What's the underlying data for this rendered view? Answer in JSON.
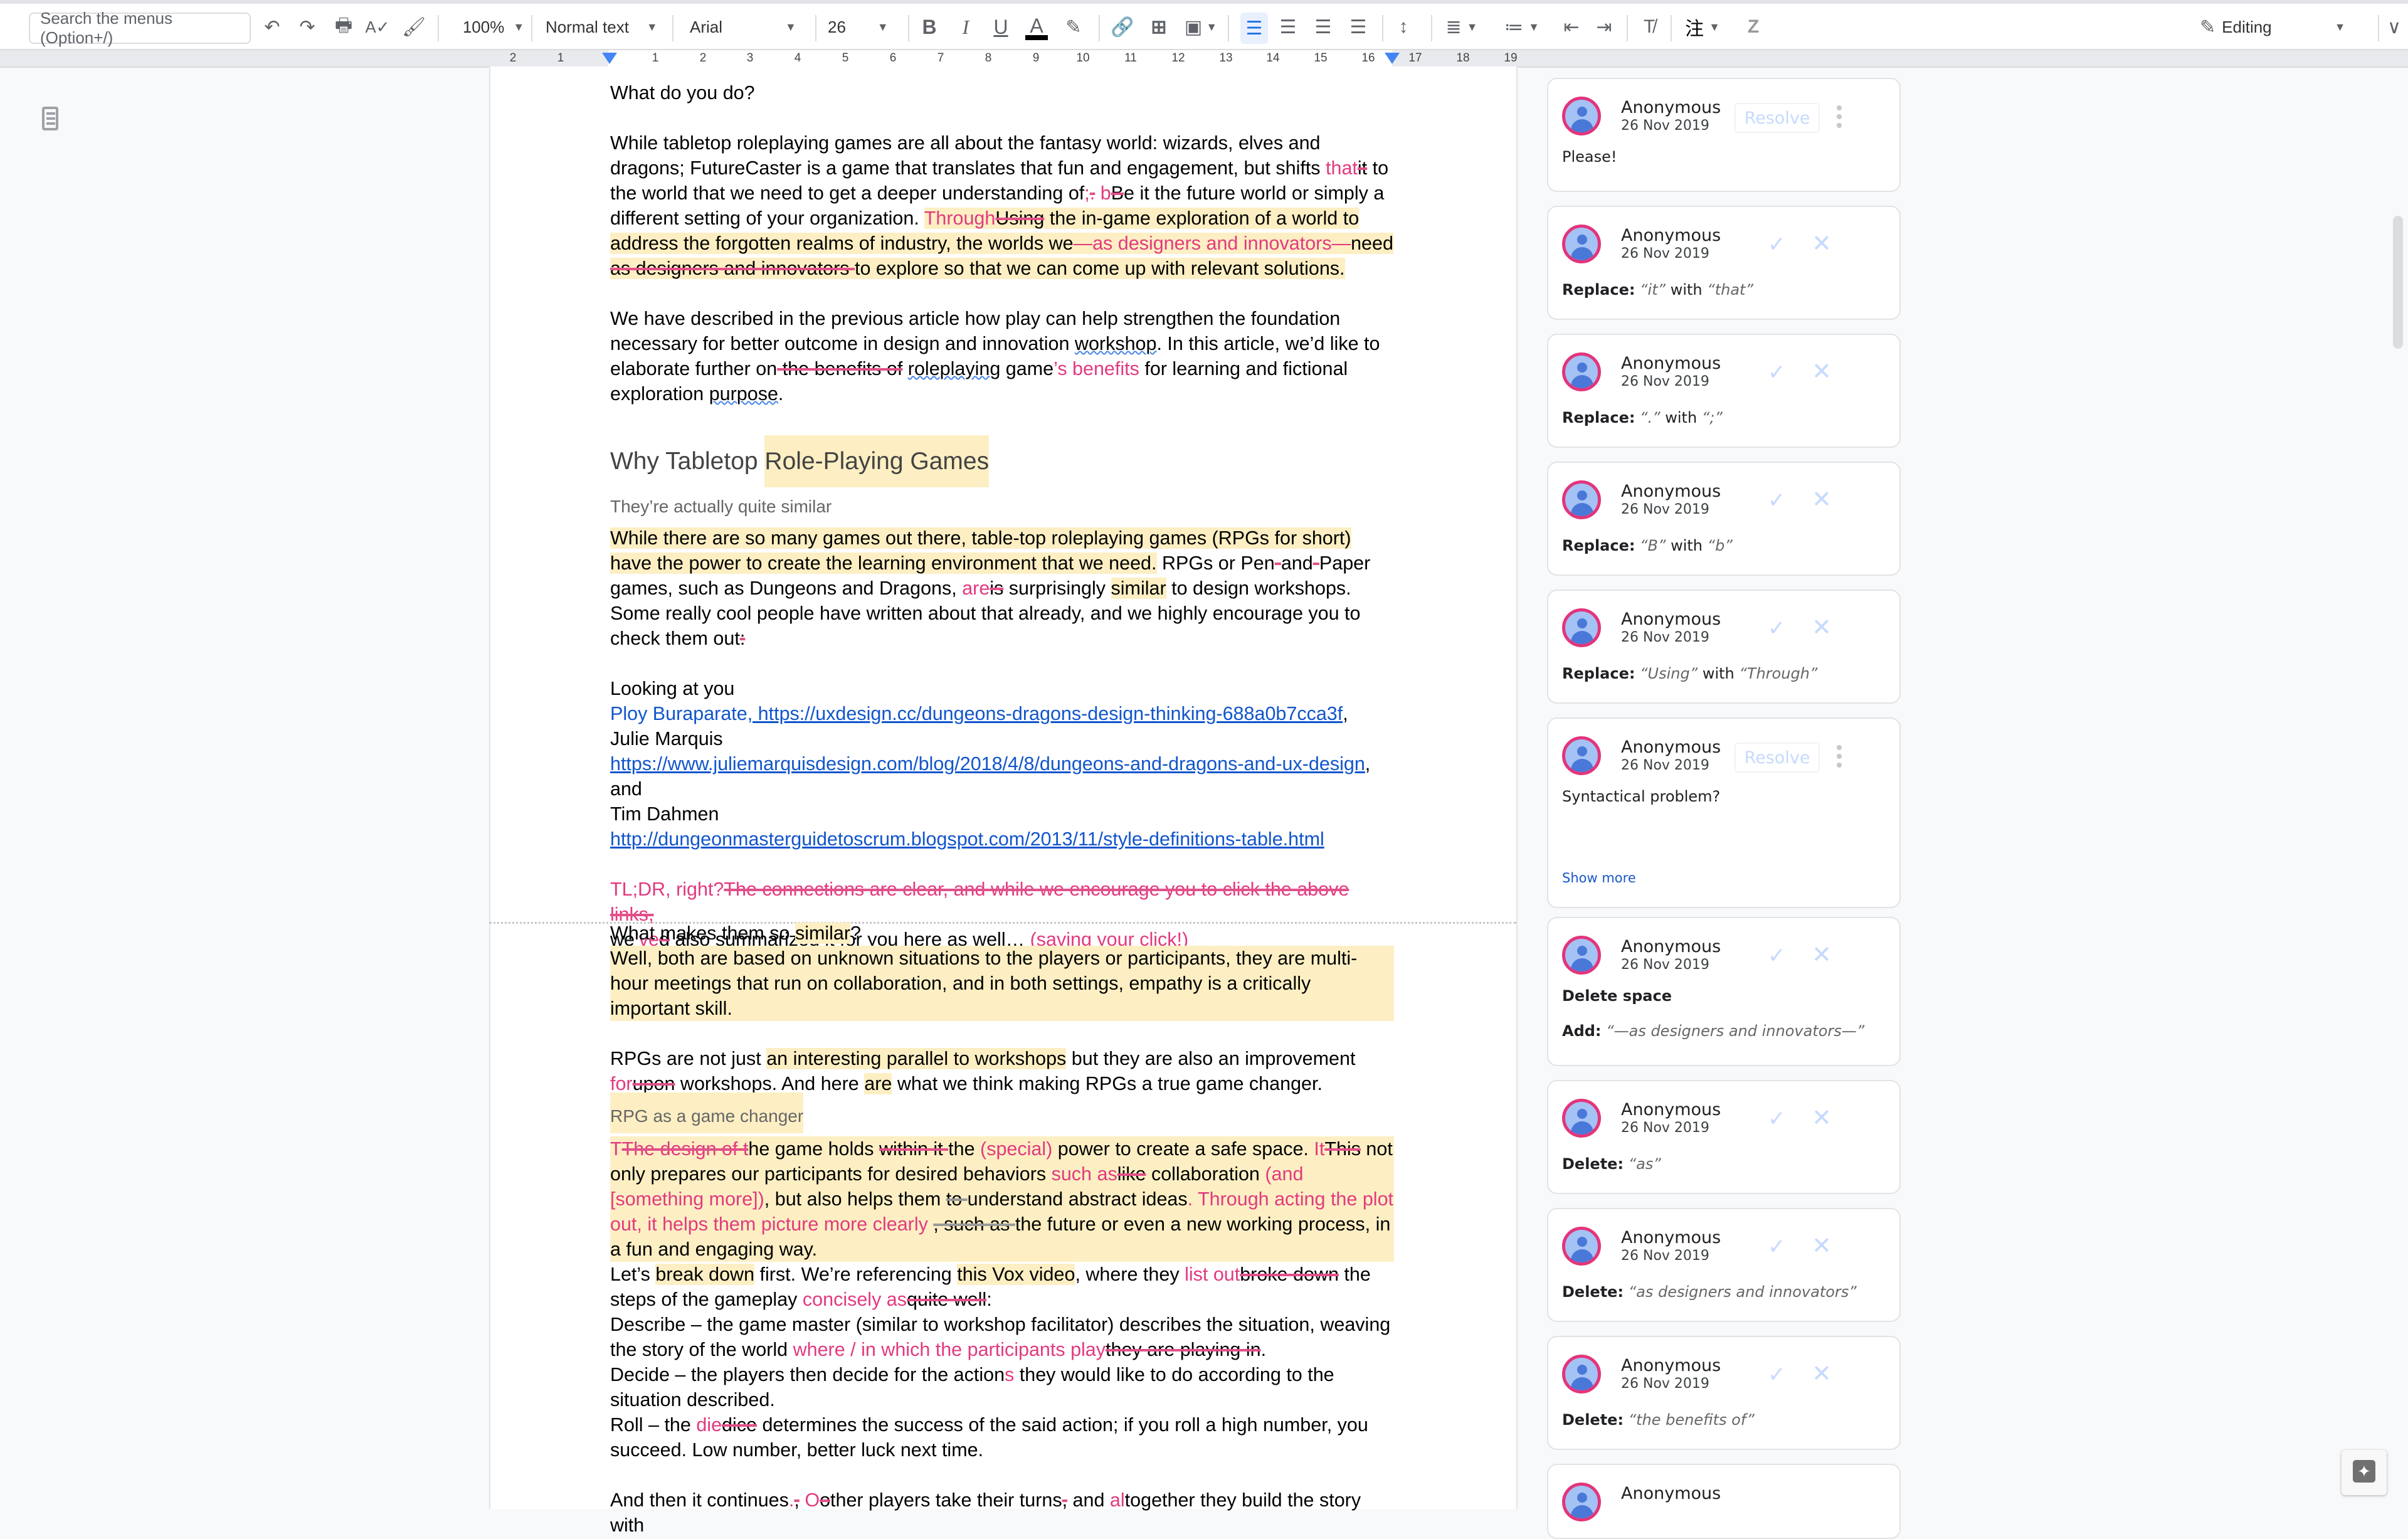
{
  "toolbar": {
    "search_placeholder": "Search the menus (Option+/)",
    "zoom": "100%",
    "style": "Normal text",
    "font": "Arial",
    "font_size": "26",
    "mode": "Editing",
    "icons": [
      "undo-icon",
      "redo-icon",
      "print-icon",
      "spellcheck-icon",
      "paint-format-icon",
      "bold-icon",
      "italic-icon",
      "underline-icon",
      "text-color-icon",
      "highlight-icon",
      "link-icon",
      "add-comment-icon",
      "image-icon",
      "align-left-icon",
      "align-center-icon",
      "align-right-icon",
      "justify-icon",
      "line-spacing-icon",
      "numbered-list-icon",
      "bulleted-list-icon",
      "decrease-indent-icon",
      "increase-indent-icon",
      "clear-formatting-icon",
      "input-tools-icon",
      "z-icon"
    ],
    "colors": {
      "text_color": "#000000",
      "active_align": "#1a73e8"
    }
  },
  "ruler": {
    "numbers": [
      "2",
      "1",
      "1",
      "2",
      "3",
      "4",
      "5",
      "6",
      "7",
      "8",
      "9",
      "10",
      "11",
      "12",
      "13",
      "14",
      "15",
      "16",
      "17",
      "18",
      "19"
    ]
  },
  "document": {
    "p1": "What do you do?",
    "p2": {
      "a": "While tabletop roleplaying games are all about the fantasy world: wizards, elves and dragons; FutureCaster is a game that translates that fun and engagement, but shifts ",
      "ins1": "that",
      "del1": "it",
      "b": " to the world that we need to get a deeper understanding of",
      "ins2": ";",
      "del2": ".",
      "c": " ",
      "ins3": "b",
      "del3": "B",
      "d": "e it the future world or simply a different setting of your organization. ",
      "ins4": "Through",
      "del4": "Using",
      "e": " the in-game exploration of a world to address the forgotten realms of industry, the worlds we",
      "ins5": "—as designers and innovators—",
      "f": "need ",
      "del5": "as designers and innovators ",
      "g": "to explore so that we can come up with relevant solutions."
    },
    "p3": {
      "a": "We have described in the previous article how play can help strengthen the foundation necessary for better outcome in design and innovation ",
      "spell1": "workshop",
      "b": ". In this article, we’d like to elaborate further on",
      "del1": " the benefits of",
      "c": " ",
      "spell2": "roleplaying",
      "d": " game",
      "ins1": "’s benefits",
      "e": " for learning and fictional exploration ",
      "spell3": "purpose",
      "f": "."
    },
    "h_why_a": "Why Tabletop ",
    "h_why_b": "Role-Playing Games",
    "sub1": "They’re actually quite similar",
    "p4": {
      "a": "While there are so many games out there, table-top roleplaying games (RPGs for short) have the power to create the learning environment that we need.",
      "b": " RPGs or Pen",
      "del1": "-",
      "c": "and",
      "del2": "-",
      "d": "Paper games, such as Dungeons and Dragons, ",
      "ins1": "are",
      "del3": "is",
      "e": " surprisingly ",
      "hl1": "similar",
      "f": " to design workshops. Some really cool people have written about that already, and we highly encourage you to check them out",
      "del4": ":"
    },
    "looking": "Looking at you",
    "ref1_name": "Ploy Buraparate",
    "ref1_url": ", https://uxdesign.cc/dungeons-dragons-design-thinking-688a0b7cca3f",
    "ref1_tail": ",",
    "ref2_name": "Julie Marquis",
    "ref2_url": "https://www.juliemarquisdesign.com/blog/2018/4/8/dungeons-and-dragons-and-ux-design",
    "ref2_tail": ", and",
    "ref3_name": "Tim Dahmen",
    "ref3_url": "http://dungeonmasterguidetoscrum.blogspot.com/2013/11/style-definitions-table.html",
    "tldr": {
      "ins1": "TL;DR, right?",
      "del1": "The connections are clear, and while we encourage you to click the above links,",
      "a": "we’",
      "ins2": "ve",
      "del2": "d",
      "b": " also summarized it for you here as well… ",
      "ins3": "(saving your click!)"
    },
    "q_a": "What makes them so ",
    "q_hl": "similar",
    "q_b": "?",
    "p5": "Well, both are based on unknown situations to the players or participants, they are multi-hour meetings that run on collaboration, and in both settings, empathy is a critically important skill.",
    "p6": {
      "a": "RPGs are not just ",
      "hl1": "an interesting parallel to workshops",
      "b": " but they are also an improvement ",
      "ins1": "for",
      "del1": "upon",
      "c": " workshops. And here ",
      "hl2": "are",
      "d": " what we think making RPGs a true game changer."
    },
    "sub2": "RPG as a game changer",
    "p7": {
      "ins1": "T",
      "del1": "The design of t",
      "a": "he game holds ",
      "del2": "within it ",
      "b": "the ",
      "ins2": "(special)",
      "c": " power to create a safe space. ",
      "ins3": "It",
      "del3": "This",
      "d": " not only prepares our participants for desired behaviors ",
      "ins4": "such as",
      "del4": "like",
      "e": " collaboration ",
      "ins5": "(and [something more])",
      "f": ", but also helps them ",
      "del5": "to ",
      "g": "understand abstract ideas",
      "ins6": ". Through acting the plot out, it helps them picture more clearly ",
      "del6": ", such as ",
      "h": "the future or even a new working process, in a fun and engaging way."
    },
    "p8": {
      "a": "Let’s ",
      "hl1": "break down",
      "b": " first. We’re referencing ",
      "hl2": "this Vox video",
      "c": ", where they ",
      "ins1": "list out",
      "del1": "broke down",
      "d": " the steps of the gameplay ",
      "ins2": "concisely as",
      "del2": "quite well",
      "e": ":"
    },
    "p9": {
      "a": "Describe – the game master (similar to workshop facilitator) describes the situation, weaving the story of the world ",
      "ins1": "where / in which the participants play",
      "del1": "they are playing in",
      "b": "."
    },
    "p10": {
      "a": "Decide – the players then decide for the action",
      "ins1": "s",
      "b": " they would like to do according to the situation described."
    },
    "p11": {
      "a": "Roll – the ",
      "ins1": "die",
      "del1": "dice",
      "b": " determines the success of the said action; if you roll a high number, you succeed. Low number, better luck next time."
    },
    "p12": {
      "a": "And then it continues",
      "ins1": ".",
      "del1": ",",
      "b": " ",
      "ins2": "O",
      "del2": "o",
      "c": "ther players take their turns",
      "del3": ",",
      "d": " and ",
      "ins3": "al",
      "e": "together they build the story with"
    }
  },
  "comments": [
    {
      "author": "Anonymous",
      "date": "26 Nov 2019",
      "type": "comment",
      "resolve": "Resolve",
      "text": "Please!"
    },
    {
      "author": "Anonymous",
      "date": "26 Nov 2019",
      "type": "suggestion",
      "label": "Replace:",
      "from": "“it”",
      "with": "with",
      "to": "“that”"
    },
    {
      "author": "Anonymous",
      "date": "26 Nov 2019",
      "type": "suggestion",
      "label": "Replace:",
      "from": "“.”",
      "with": "with",
      "to": "“;”"
    },
    {
      "author": "Anonymous",
      "date": "26 Nov 2019",
      "type": "suggestion",
      "label": "Replace:",
      "from": "“B”",
      "with": "with",
      "to": "“b”"
    },
    {
      "author": "Anonymous",
      "date": "26 Nov 2019",
      "type": "suggestion",
      "label": "Replace:",
      "from": "“Using”",
      "with": "with",
      "to": "“Through”"
    },
    {
      "author": "Anonymous",
      "date": "26 Nov 2019",
      "type": "comment",
      "resolve": "Resolve",
      "text": "Syntactical problem?",
      "show_more": "Show more"
    },
    {
      "author": "Anonymous",
      "date": "26 Nov 2019",
      "type": "suggestion",
      "label": "Delete space",
      "label2": "Add:",
      "to": "“—as designers and innovators—”"
    },
    {
      "author": "Anonymous",
      "date": "26 Nov 2019",
      "type": "suggestion",
      "label": "Delete:",
      "to": "“as”"
    },
    {
      "author": "Anonymous",
      "date": "26 Nov 2019",
      "type": "suggestion",
      "label": "Delete:",
      "to": "“as designers and innovators”"
    },
    {
      "author": "Anonymous",
      "date": "26 Nov 2019",
      "type": "suggestion",
      "label": "Delete:",
      "to": "“the benefits of”"
    },
    {
      "author": "Anonymous"
    }
  ],
  "colors": {
    "insertion": "#e23a7f",
    "highlight": "#fdefc3",
    "link": "#1155cc",
    "avatar_ring": "#e4347b"
  }
}
